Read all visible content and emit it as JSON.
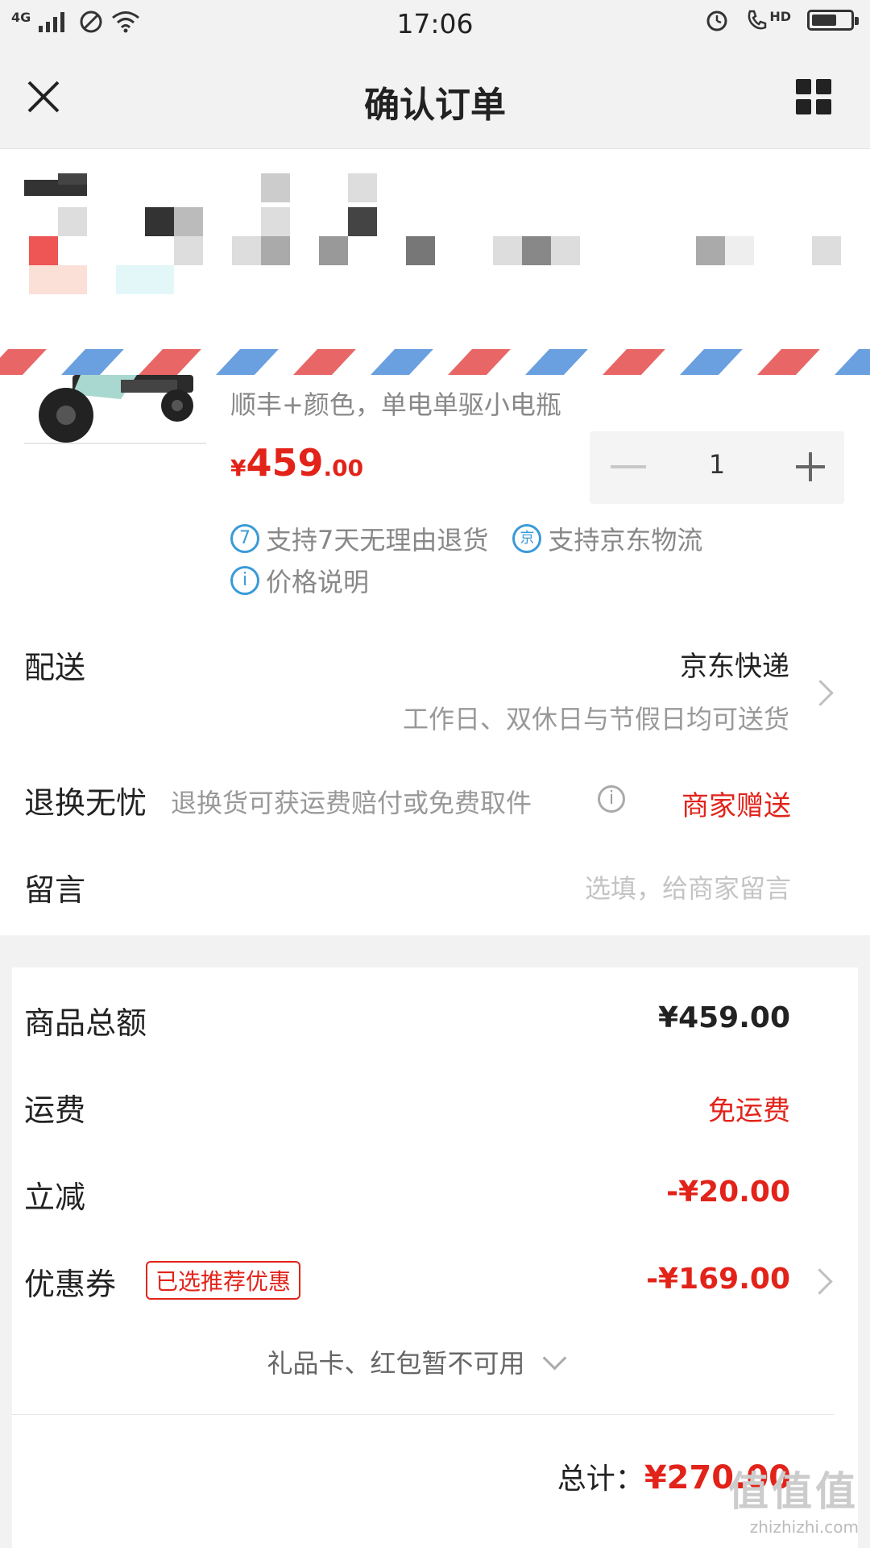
{
  "status_bar": {
    "network": "4G",
    "time": "17:06",
    "hd": "HD"
  },
  "nav": {
    "title": "确认订单"
  },
  "product": {
    "spec": "顺丰+颜色，单电单驱小电瓶",
    "price_currency": "¥",
    "price_int": "459",
    "price_dec": ".00",
    "quantity": "1",
    "services": [
      {
        "icon": "7",
        "label": "支持7天无理由退货"
      },
      {
        "icon": "京",
        "label": "支持京东物流"
      }
    ],
    "price_note_icon": "i",
    "price_note": "价格说明"
  },
  "delivery": {
    "label": "配送",
    "method": "京东快递",
    "note": "工作日、双休日与节假日均可送货"
  },
  "return_worry_free": {
    "label": "退换无忧",
    "desc": "退换货可获运费赔付或免费取件",
    "info_icon": "i",
    "value": "商家赠送"
  },
  "message": {
    "label": "留言",
    "placeholder": "选填，给商家留言"
  },
  "summary": {
    "goods_total_label": "商品总额",
    "goods_total": "¥459.00",
    "shipping_label": "运费",
    "shipping": "免运费",
    "discount_label": "立减",
    "discount": "-¥20.00",
    "coupon_label": "优惠券",
    "coupon_tag": "已选推荐优惠",
    "coupon": "-¥169.00",
    "giftcard_note": "礼品卡、红包暂不可用",
    "total_label": "总计：",
    "total": "¥270.00"
  },
  "watermark": {
    "big": "值值值",
    "small": "zhizhizhi.com"
  },
  "colors": {
    "accent_red": "#e2231a",
    "service_blue": "#3a9ad9"
  }
}
